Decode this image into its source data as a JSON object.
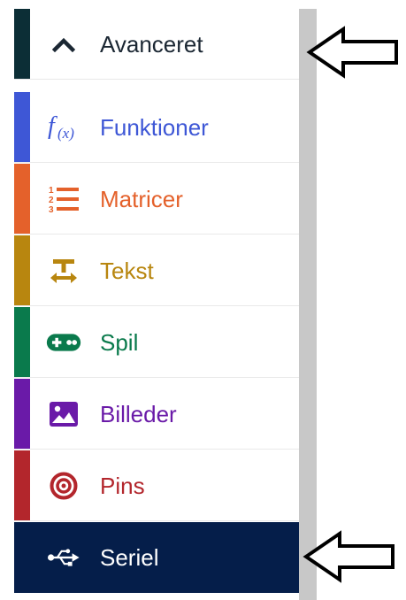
{
  "categories": [
    {
      "id": "advanced",
      "label": "Avanceret",
      "color": "#0c2e36",
      "text_color": "#1b2733",
      "icon": "chevron-up-icon"
    },
    {
      "id": "functions",
      "label": "Funktioner",
      "color": "#3e57d6",
      "text_color": "#3e57d6",
      "icon": "function-icon"
    },
    {
      "id": "arrays",
      "label": "Matricer",
      "color": "#e4612b",
      "text_color": "#e4612b",
      "icon": "numbered-list-icon"
    },
    {
      "id": "text",
      "label": "Tekst",
      "color": "#b8860f",
      "text_color": "#b8860f",
      "icon": "text-format-icon"
    },
    {
      "id": "game",
      "label": "Spil",
      "color": "#0a7a4c",
      "text_color": "#0a7a4c",
      "icon": "gamepad-icon"
    },
    {
      "id": "images",
      "label": "Billeder",
      "color": "#6a1aa8",
      "text_color": "#6a1aa8",
      "icon": "image-icon"
    },
    {
      "id": "pins",
      "label": "Pins",
      "color": "#b3262c",
      "text_color": "#b3262c",
      "icon": "target-icon"
    },
    {
      "id": "serial",
      "label": "Seriel",
      "color": "#051e4a",
      "text_color": "#ffffff",
      "icon": "usb-icon",
      "selected": true
    }
  ]
}
